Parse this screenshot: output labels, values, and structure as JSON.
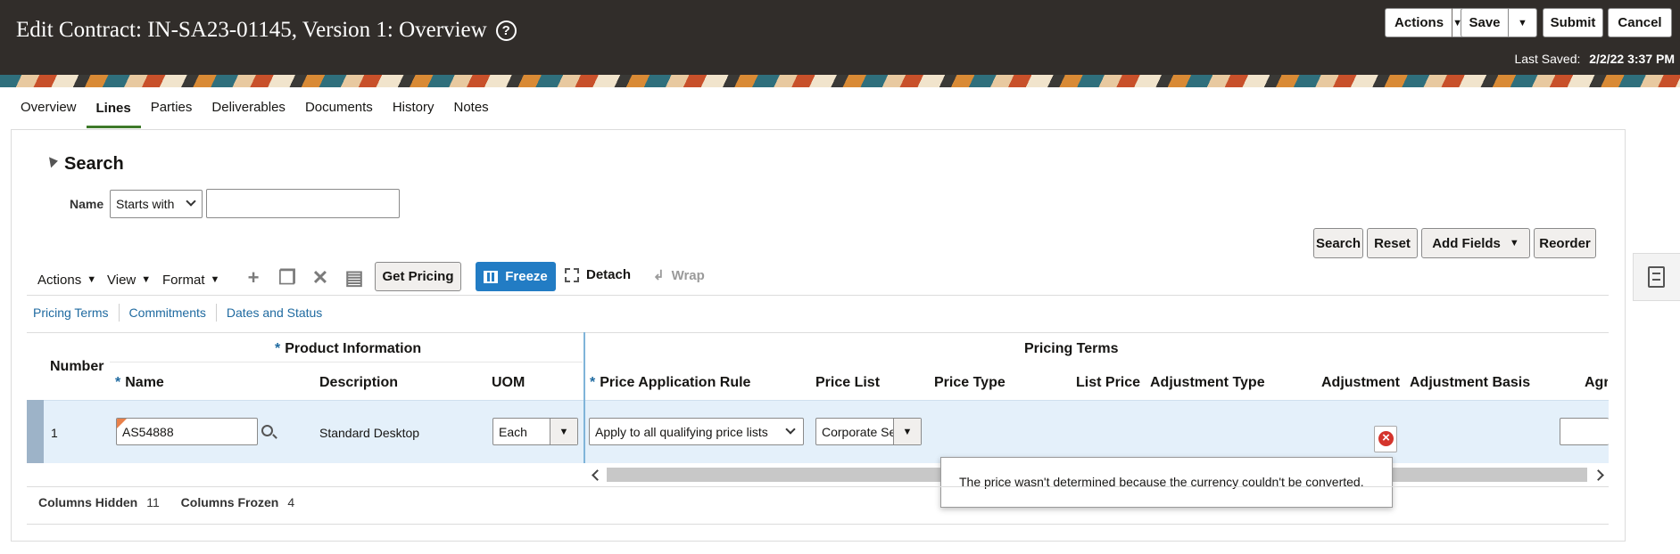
{
  "header": {
    "title": "Edit Contract: IN-SA23-01145, Version 1: Overview",
    "actions_label": "Actions",
    "save_label": "Save",
    "submit_label": "Submit",
    "cancel_label": "Cancel",
    "last_saved_label": "Last Saved:",
    "last_saved_value": "2/2/22 3:37 PM"
  },
  "tabs": [
    {
      "label": "Overview"
    },
    {
      "label": "Lines",
      "active": true
    },
    {
      "label": "Parties"
    },
    {
      "label": "Deliverables"
    },
    {
      "label": "Documents"
    },
    {
      "label": "History"
    },
    {
      "label": "Notes"
    }
  ],
  "search": {
    "title": "Search",
    "name_label": "Name",
    "operator_value": "Starts with",
    "name_value": "",
    "buttons": {
      "search": "Search",
      "reset": "Reset",
      "add_fields": "Add Fields",
      "reorder": "Reorder"
    }
  },
  "toolbar": {
    "actions": "Actions",
    "view": "View",
    "format": "Format",
    "get_pricing": "Get Pricing",
    "freeze": "Freeze",
    "detach": "Detach",
    "wrap": "Wrap"
  },
  "sublinks": [
    "Pricing Terms",
    "Commitments",
    "Dates and Status"
  ],
  "table": {
    "groups": {
      "product_information": "Product Information",
      "pricing_terms": "Pricing Terms"
    },
    "columns": {
      "number": "Number",
      "name": "Name",
      "description": "Description",
      "uom": "UOM",
      "price_application_rule": "Price Application Rule",
      "price_list": "Price List",
      "price_type": "Price Type",
      "list_price": "List Price",
      "adjustment_type": "Adjustment Type",
      "adjustment": "Adjustment",
      "adjustment_basis": "Adjustment Basis",
      "agr": "Agr"
    },
    "rows": [
      {
        "number": "1",
        "name": "AS54888",
        "description": "Standard Desktop",
        "uom": "Each",
        "price_application_rule": "Apply to all qualifying price lists",
        "price_list": "Corporate Se"
      }
    ]
  },
  "tooltip": "The price wasn't determined because the currency couldn't be converted.",
  "footer": {
    "columns_hidden_label": "Columns Hidden",
    "columns_hidden_value": "11",
    "columns_frozen_label": "Columns Frozen",
    "columns_frozen_value": "4"
  },
  "colors": {
    "header_bg": "#312d2a",
    "accent_blue": "#227cc4",
    "link_blue": "#1f6aa0",
    "row_selected": "#e4f0fa",
    "error_red": "#d4342c",
    "tab_active": "#3e7a2a"
  }
}
